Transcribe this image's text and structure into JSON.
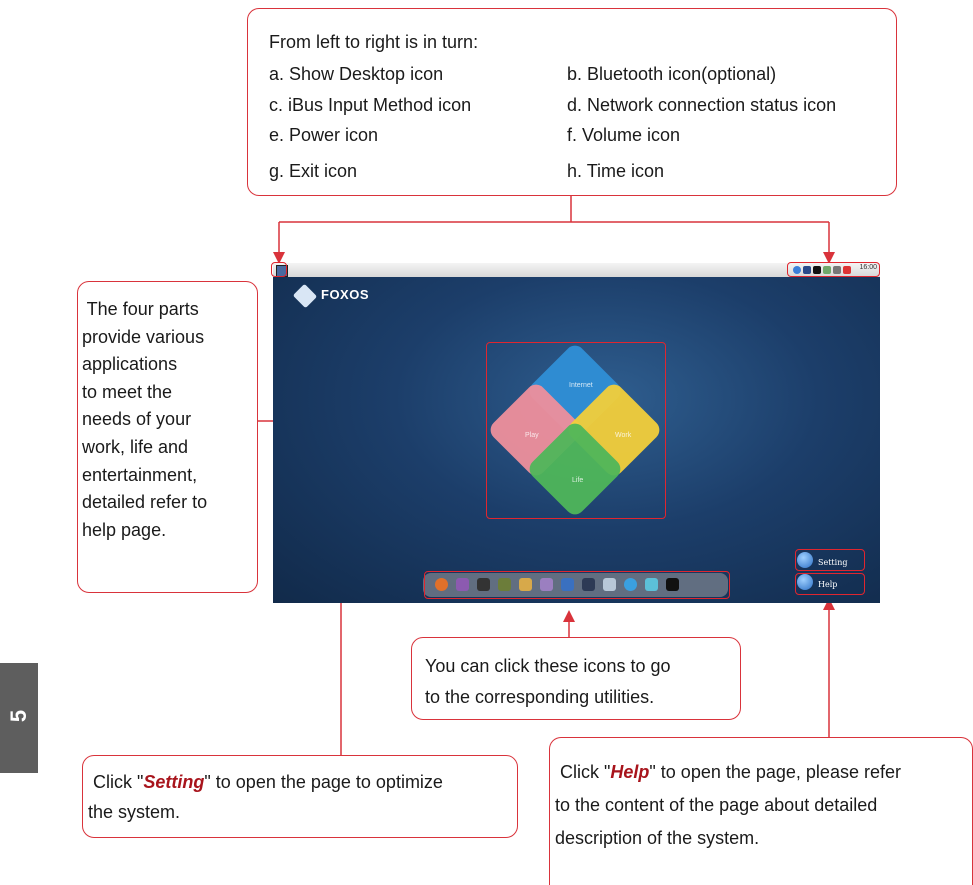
{
  "top_callout": {
    "heading": "From left to right is in turn:",
    "items": [
      "a. Show Desktop icon",
      "b. Bluetooth icon(optional)",
      "c. iBus Input Method icon",
      "d. Network connection status icon",
      "e. Power icon",
      "f. Volume icon",
      "g. Exit icon",
      "h. Time icon"
    ]
  },
  "left_callout": {
    "lines": [
      " The four parts",
      "provide various",
      "applications",
      "to meet the",
      "needs of your",
      "work, life and",
      "entertainment,",
      "detailed refer to",
      "help page."
    ]
  },
  "icons_callout": {
    "line1": "You can click these icons to go",
    "line2": "to the corresponding utilities."
  },
  "setting_callout": {
    "prefix": " Click \"",
    "keyword": "Setting",
    "suffix": "\" to open the page to optimize",
    "line2": "the system."
  },
  "help_callout": {
    "prefix": " Click \"",
    "keyword": "Help",
    "suffix": "\" to open the page, please refer",
    "line2": "to the content of the page about detailed",
    "line3": "description of the system."
  },
  "screenshot": {
    "logo_text": "FOXOS",
    "time_text": "16:00",
    "puzzle_labels": [
      "Internet",
      "Play",
      "Work",
      "Life"
    ],
    "setting_label": "Setting",
    "help_label": "Help"
  },
  "chapter_tab": "5",
  "colors": {
    "callout_border": "#d9333b",
    "keyword": "#a8141c",
    "puzzle_blue": "#2f8fd6",
    "puzzle_pink": "#ee8f9c",
    "puzzle_yellow": "#f2cf3a",
    "puzzle_green": "#4fb65a",
    "tab_bg": "#5e5e5e"
  }
}
